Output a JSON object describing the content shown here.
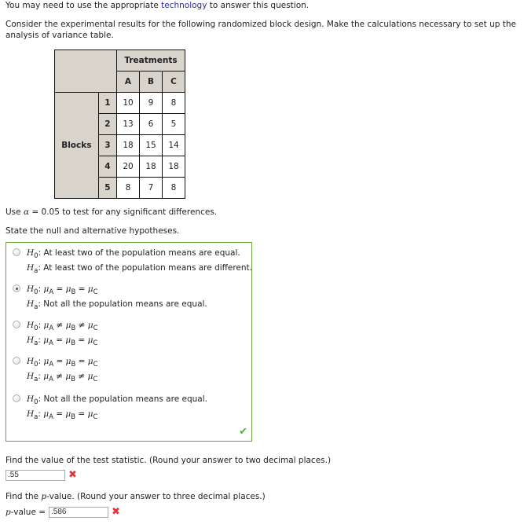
{
  "intro": {
    "prefix": "You may need to use the appropriate ",
    "link": "technology",
    "suffix": " to answer this question."
  },
  "question": {
    "line1": "Consider the experimental results for the following randomized block design. Make the calculations necessary to set up the",
    "line2": "analysis of variance table."
  },
  "table": {
    "treatments_label": "Treatments",
    "blocks_label": "Blocks",
    "treatments": [
      "A",
      "B",
      "C"
    ],
    "rows": [
      {
        "block": "1",
        "values": [
          "10",
          "9",
          "8"
        ]
      },
      {
        "block": "2",
        "values": [
          "13",
          "6",
          "5"
        ]
      },
      {
        "block": "3",
        "values": [
          "18",
          "15",
          "14"
        ]
      },
      {
        "block": "4",
        "values": [
          "20",
          "18",
          "18"
        ]
      },
      {
        "block": "5",
        "values": [
          "8",
          "7",
          "8"
        ]
      }
    ]
  },
  "alpha_text": {
    "prefix": "Use ",
    "symbol": "α",
    "suffix": " = 0.05 to test for any significant differences."
  },
  "hypotheses_prompt": "State the null and alternative hypotheses.",
  "options": [
    {
      "selected": false,
      "h0": ": At least two of the population means are equal.",
      "ha": ": At least two of the population means are different."
    },
    {
      "selected": true,
      "h0": ": μA = μB = μC",
      "ha": ": Not all the population means are equal."
    },
    {
      "selected": false,
      "h0": ": μA ≠ μB ≠ μC",
      "ha": ": μA = μB = μC"
    },
    {
      "selected": false,
      "h0": ": μA = μB = μC",
      "ha": ": μA ≠ μB ≠ μC"
    },
    {
      "selected": false,
      "h0": ": Not all the population means are equal.",
      "ha": ": μA = μB = μC"
    }
  ],
  "labels": {
    "h0": "H",
    "h0_sub": "0",
    "ha": "H",
    "ha_sub": "a",
    "mu": "μ",
    "sub_a": "A",
    "sub_b": "B",
    "sub_c": "C",
    "eq": " = ",
    "neq": " ≠ ",
    "colon": ": "
  },
  "hypothesis_status": {
    "icon": "check-icon",
    "glyph": "✔",
    "color": "#4fae3c"
  },
  "test_statistic": {
    "prompt": "Find the value of the test statistic. (Round your answer to two decimal places.)",
    "value": ".55",
    "status_glyph": "✖",
    "status_color": "#e0353a"
  },
  "p_value": {
    "prompt_prefix": "Find the ",
    "prompt_p": "p",
    "prompt_suffix": "-value. (Round your answer to three decimal places.)",
    "label_p": "p",
    "label_suffix": "-value = ",
    "value": ".586",
    "status_glyph": "✖",
    "status_color": "#e0353a"
  },
  "colors": {
    "link": "#2a2a9e",
    "table_header_bg": "#d8d4cb",
    "answer_border": "#6aa63b"
  }
}
